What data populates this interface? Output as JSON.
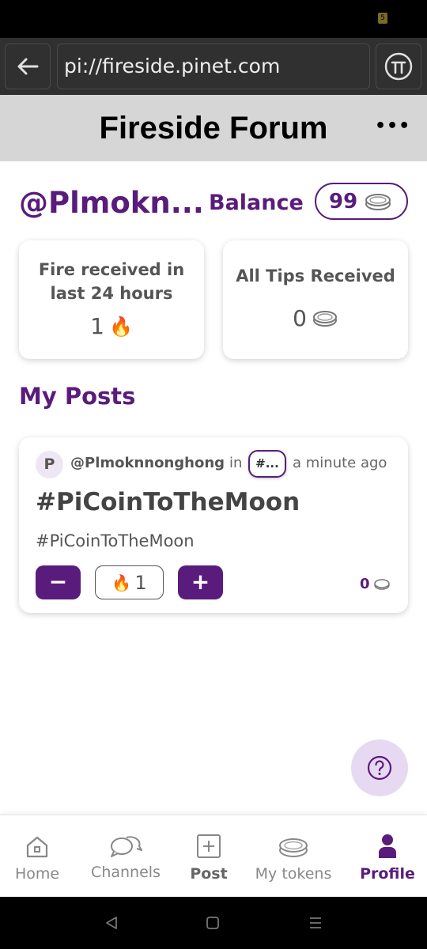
{
  "status_bar": {
    "battery_text": "5"
  },
  "browser": {
    "url": "pi://fireside.pinet.com"
  },
  "app": {
    "title": "Fireside Forum",
    "more_label": "•••"
  },
  "profile": {
    "username": "@Plmokn...",
    "balance_label": "Balance",
    "balance_value": "99"
  },
  "stats": {
    "fire_title": "Fire received in last 24 hours",
    "fire_value": "1",
    "tips_title": "All Tips Received",
    "tips_value": "0"
  },
  "section": {
    "my_posts": "My Posts"
  },
  "post": {
    "avatar_letter": "P",
    "author": "@Plmoknnonghong",
    "in_label": "in",
    "channel": "#...",
    "time": "a minute ago",
    "title": "#PiCoinToTheMoon",
    "body": "#PiCoinToTheMoon",
    "minus_label": "−",
    "fire_count": "1",
    "plus_label": "+",
    "tips": "0"
  },
  "nav": {
    "home": "Home",
    "channels": "Channels",
    "post": "Post",
    "my_tokens": "My tokens",
    "profile": "Profile",
    "active": "profile"
  },
  "colors": {
    "brand": "#5a1c7c",
    "header_bg": "#d6d6d6",
    "browser_bg": "#303030"
  }
}
